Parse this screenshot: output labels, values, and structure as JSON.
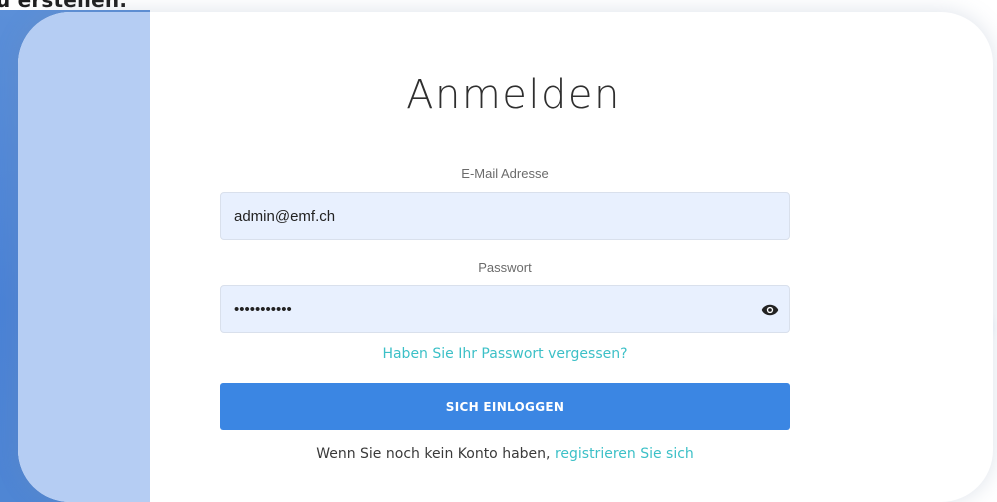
{
  "page": {
    "top_fragment_text": "u erstellen."
  },
  "login_form": {
    "title": "Anmelden",
    "email_label": "E-Mail Adresse",
    "email_value": "admin@emf.ch",
    "password_label": "Passwort",
    "password_value": "admin123456",
    "forgot_password_link": "Haben Sie Ihr Passwort vergessen?",
    "submit_button": "SICH EINLOGGEN",
    "register_prompt": "Wenn Sie noch kein Konto haben,",
    "register_link": "registrieren Sie sich"
  },
  "colors": {
    "primary_button": "#3b86e3",
    "link": "#3cc0c7",
    "input_background": "#e8f0fe",
    "backdrop_blue": "#4a82d6"
  },
  "icons": {
    "password_toggle": "eye-icon"
  }
}
